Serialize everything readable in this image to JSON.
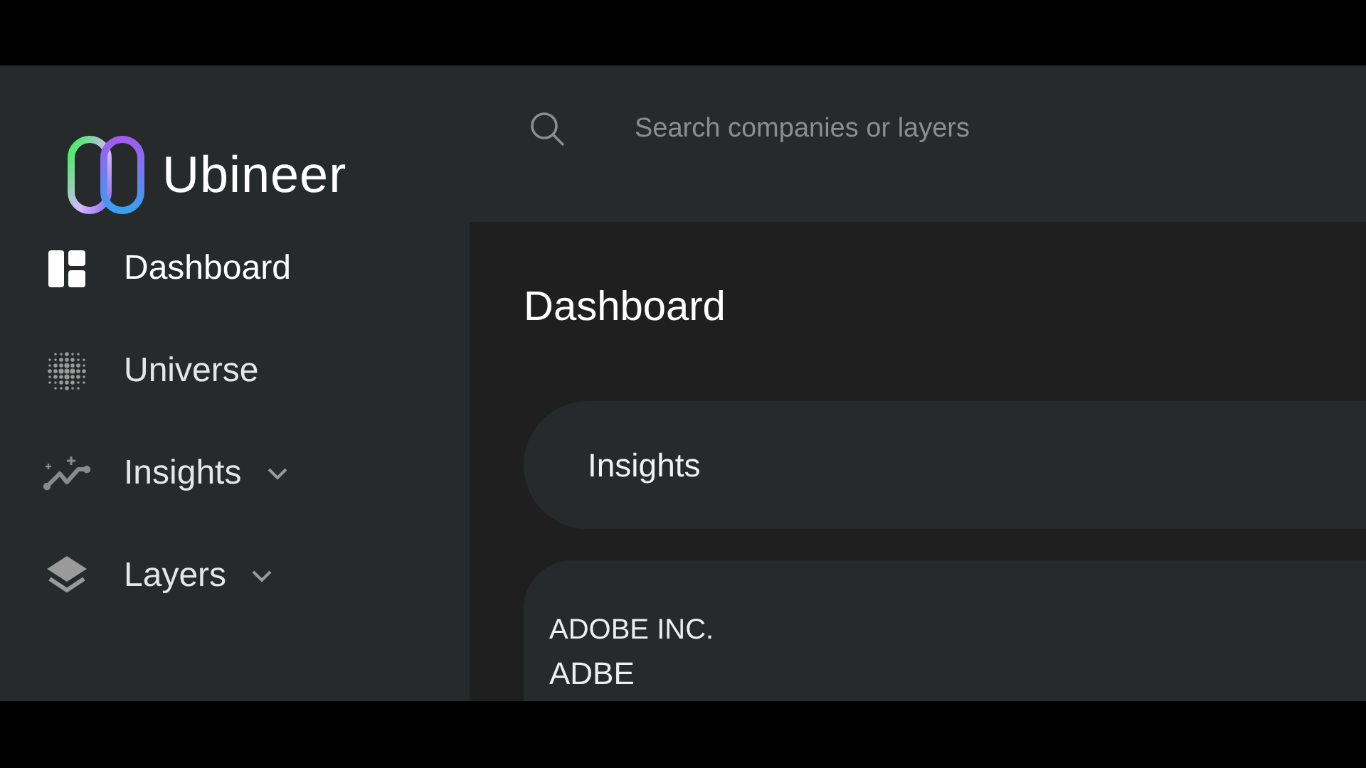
{
  "brand": {
    "name": "Ubineer"
  },
  "search": {
    "placeholder": "Search companies or layers"
  },
  "sidebar": {
    "items": [
      {
        "label": "Dashboard",
        "kind": "link",
        "selected": true
      },
      {
        "label": "Universe",
        "kind": "link",
        "selected": false
      },
      {
        "label": "Insights",
        "kind": "group",
        "selected": false
      },
      {
        "label": "Layers",
        "kind": "group",
        "selected": false
      }
    ]
  },
  "main": {
    "title": "Dashboard",
    "insights_bar": {
      "title": "Insights"
    },
    "company_card": {
      "name": "ADOBE INC.",
      "ticker": "ADBE"
    }
  }
}
